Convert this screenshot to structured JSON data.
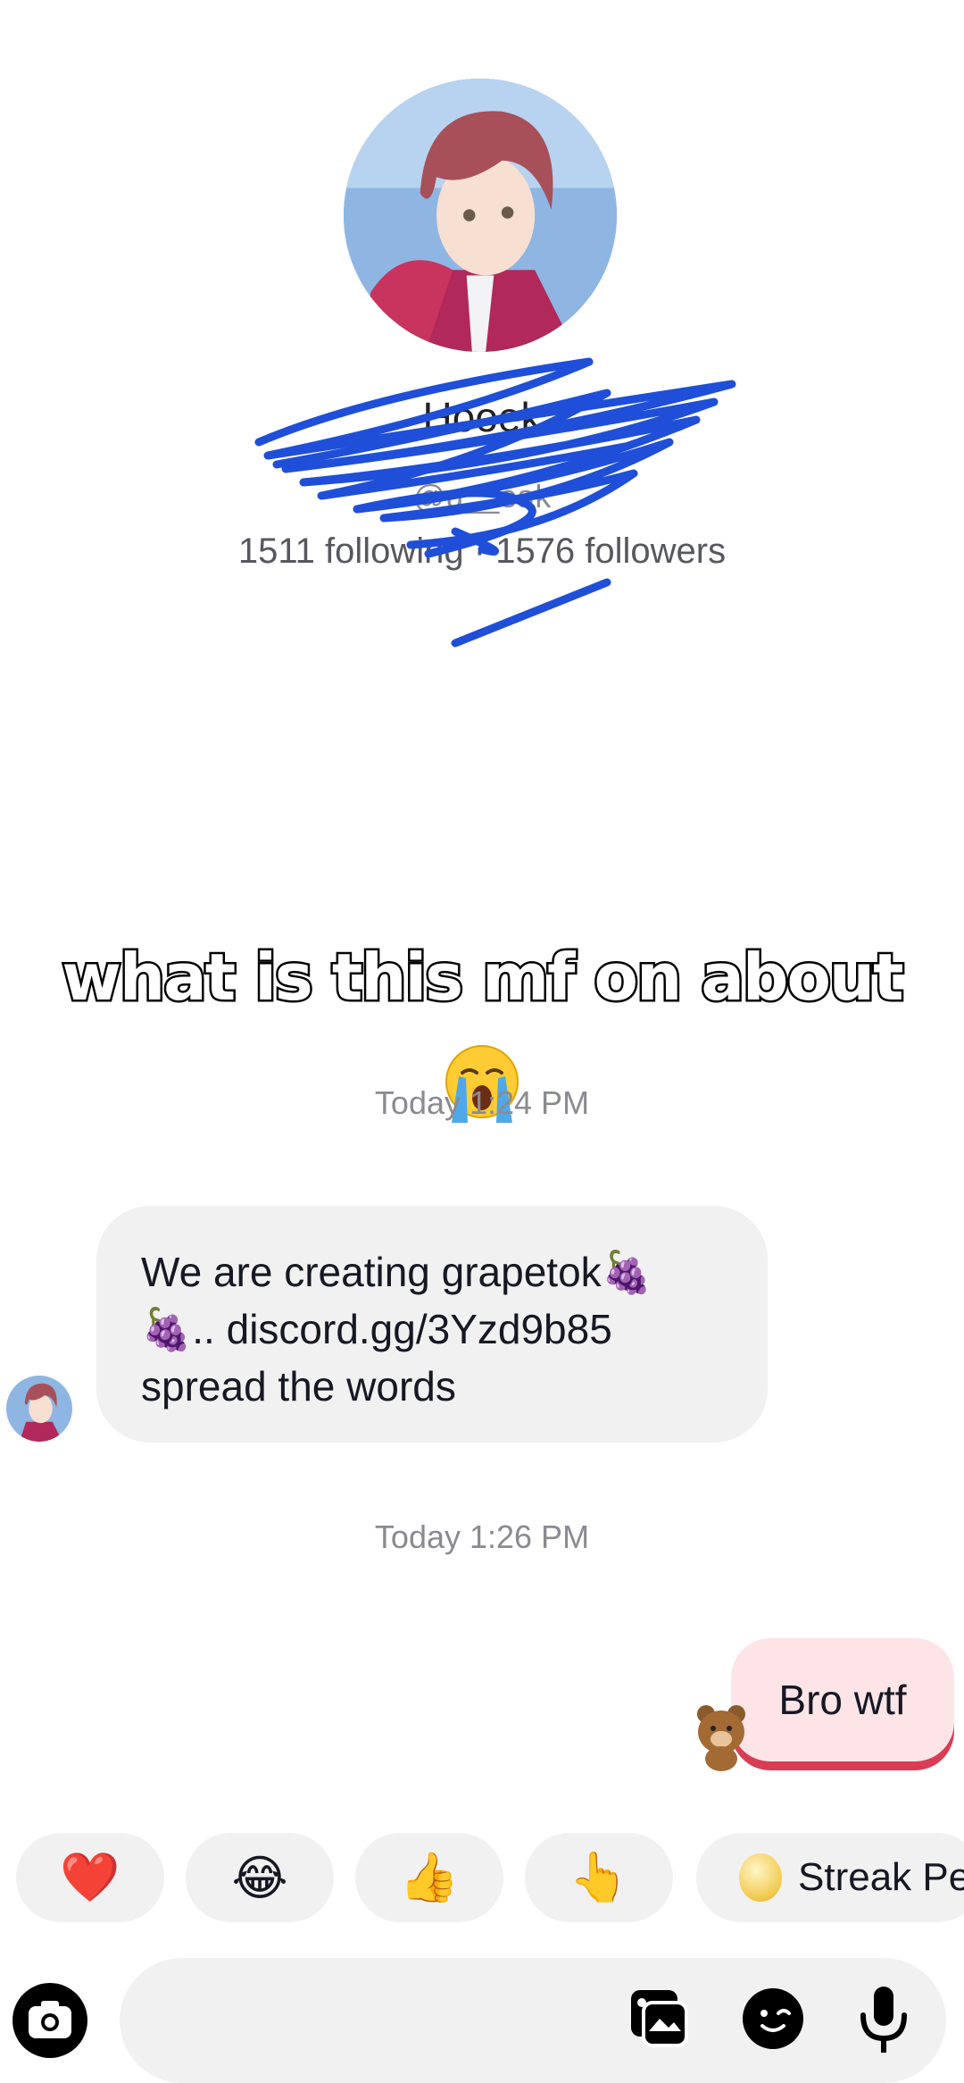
{
  "profile": {
    "display_name": "Hooek",
    "username": "@u__eak",
    "stats": "1511 following · 1576 followers"
  },
  "overlay": {
    "caption": "what is this mf on about",
    "emoji": "😭"
  },
  "conversation": {
    "timestamp_1": "Today 1:24 PM",
    "incoming_message": "We are creating grapetok🍇🍇.. discord.gg/3Yzd9b85 spread the words",
    "timestamp_2": "Today 1:26 PM",
    "outgoing_message": "Bro wtf"
  },
  "quick_reactions": {
    "heart": "❤️",
    "laugh": "😂",
    "thumbs_up": "👍",
    "point": "👆",
    "streak_label": "Streak Pet"
  },
  "icons": {
    "camera": "camera-icon",
    "gallery": "gallery-icon",
    "emoji": "emoji-icon",
    "mic": "mic-icon"
  },
  "colors": {
    "bubble_incoming": "#f1f1f2",
    "bubble_outgoing": "#fde4e7",
    "outgoing_accent": "#d93d55",
    "scribble": "#1f4fd8",
    "muted_text": "#8a8b91"
  }
}
